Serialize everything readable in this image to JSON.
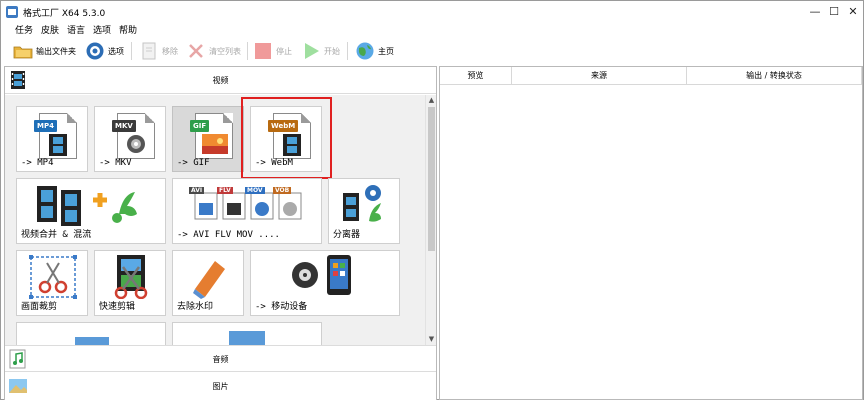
{
  "window": {
    "title": "格式工厂 X64 5.3.0",
    "minimize": "—",
    "maximize": "☐",
    "close": "✕"
  },
  "menu": [
    "任务",
    "皮肤",
    "语言",
    "选项",
    "帮助"
  ],
  "toolbar": {
    "output_folder": "输出文件夹",
    "options": "选项",
    "remove": "移除",
    "clear_list": "清空列表",
    "stop": "停止",
    "start": "开始",
    "home": "主页"
  },
  "categories": {
    "video": "视频",
    "audio": "音频",
    "picture": "图片"
  },
  "tiles": {
    "mp4": {
      "badge": "MP4",
      "label": "-> MP4"
    },
    "mkv": {
      "badge": "MKV",
      "label": "-> MKV"
    },
    "gif": {
      "badge": "GIF",
      "label": "-> GIF"
    },
    "webm": {
      "badge": "WebM",
      "label": "-> WebM"
    },
    "merge": {
      "label": "视频合并 & 混流"
    },
    "avi": {
      "badges": [
        "AVI",
        "FLV",
        "MOV",
        "VOB"
      ],
      "label": "-> AVI FLV MOV ...."
    },
    "splitter": {
      "label": "分离器"
    },
    "crop": {
      "label": "画面裁剪"
    },
    "quickclip": {
      "label": "快速剪辑"
    },
    "watermark": {
      "label": "去除水印"
    },
    "mobile": {
      "label": "-> 移动设备"
    }
  },
  "columns": [
    "预览",
    "来源",
    "输出 / 转换状态"
  ],
  "colors": {
    "highlight": "#e02020",
    "mp4_badge": "#1e6fb8",
    "mkv_badge": "#3a3a3a",
    "gif_badge": "#2e9e4a",
    "webm_badge": "#b86a10"
  }
}
